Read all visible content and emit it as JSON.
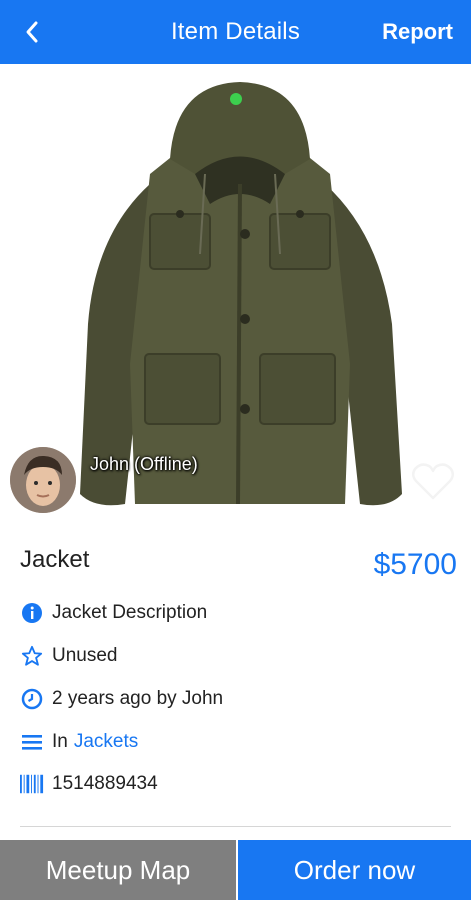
{
  "header": {
    "back_icon": "chevron-left-icon",
    "title": "Item Details",
    "report_label": "Report",
    "color": "#1877f2"
  },
  "seller": {
    "name_status": "John (Offline)",
    "status_dot_color": "#3ccf4e"
  },
  "item": {
    "title": "Jacket",
    "price": "$5700",
    "description": "Jacket Description",
    "condition": "Unused",
    "posted": "2 years ago by John",
    "category_prefix": "In",
    "category": "Jackets",
    "code": "1514889434"
  },
  "actions": {
    "map_label": "Meetup Map",
    "order_label": "Order now"
  }
}
